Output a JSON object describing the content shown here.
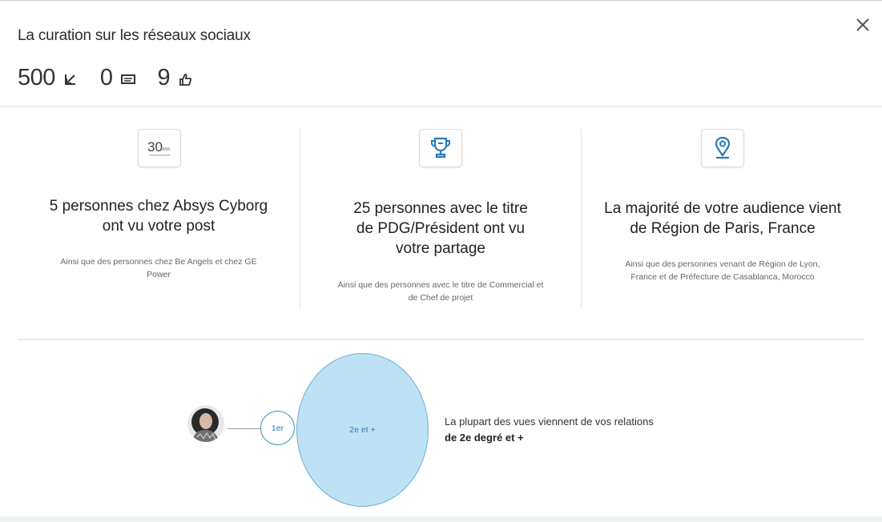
{
  "modal": {
    "title": "La curation sur les réseaux sociaux",
    "close_icon": "close-icon"
  },
  "stats": {
    "views": {
      "value": "500",
      "icon": "views-arrow-icon"
    },
    "comments": {
      "value": "0",
      "icon": "comment-icon"
    },
    "likes": {
      "value": "9",
      "icon": "thumbs-up-icon"
    }
  },
  "insights": [
    {
      "icon": "company-logo-30-ans",
      "logo_text": "30",
      "logo_sub": "ANS",
      "headline": "5 personnes chez Absys Cyborg ont vu votre post",
      "detail": "Ainsi que des personnes chez Be Angels et chez GE Power"
    },
    {
      "icon": "trophy-icon",
      "headline": "25 personnes avec le titre de PDG/Président ont vu votre partage",
      "detail": "Ainsi que des personnes avec le titre de Commercial et de Chef de projet"
    },
    {
      "icon": "location-pin-icon",
      "headline": "La majorité de votre audience vient de Région de Paris, France",
      "detail": "Ainsi que des personnes venant de Région de Lyon, France et de Préfecture de Casablanca, Morocco"
    }
  ],
  "network": {
    "first_degree_label": "1er",
    "second_degree_label": "2e et +",
    "summary_line1": "La plupart des vues viennent de vos relations",
    "summary_line2": "de 2e degré et +"
  },
  "colors": {
    "accent_blue": "#2a7ab5",
    "bubble_fill": "#bde2f6",
    "divider": "#ebebeb"
  }
}
